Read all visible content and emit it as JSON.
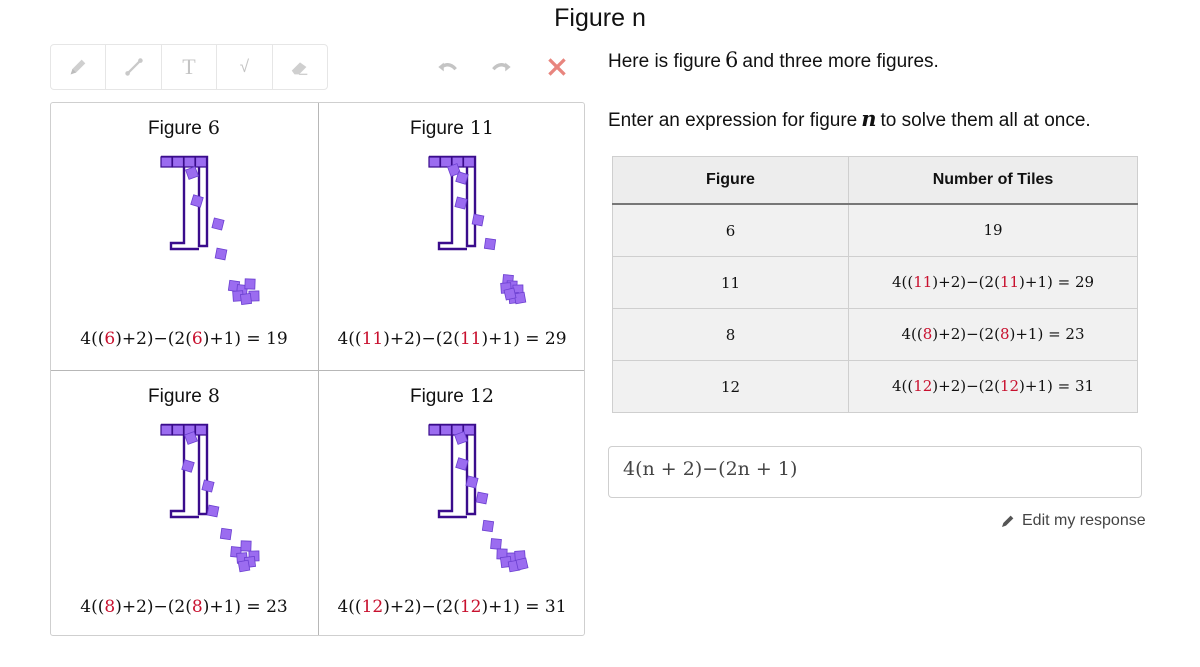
{
  "page": {
    "title": "Figure n"
  },
  "toolbar": {
    "tools": [
      {
        "icon": "pencil-icon"
      },
      {
        "icon": "line-icon"
      },
      {
        "icon": "text-icon",
        "glyph": "T"
      },
      {
        "icon": "square-root-icon",
        "glyph": "√"
      },
      {
        "icon": "eraser-icon"
      }
    ],
    "undo_icon": "undo-icon",
    "redo_icon": "redo-icon",
    "close_icon": "close-icon",
    "close_color": "#e8857e",
    "inactive_color": "#c4c4c4"
  },
  "figures": [
    {
      "label": "Figure",
      "number": "6",
      "n": "6",
      "result": "19"
    },
    {
      "label": "Figure",
      "number": "11",
      "n": "11",
      "result": "29"
    },
    {
      "label": "Figure",
      "number": "8",
      "n": "8",
      "result": "23"
    },
    {
      "label": "Figure",
      "number": "12",
      "n": "12",
      "result": "31"
    }
  ],
  "expression_parts": {
    "p1": "4(",
    "p2": "(",
    "p3": ")+2)−(2(",
    "p4": ")+1)",
    "eq": " = "
  },
  "prompt": {
    "line1_prefix": "Here is figure",
    "line1_number": "6",
    "line1_suffix": "and three more figures.",
    "line2_prefix": "Enter an expression for figure",
    "line2_var": "n",
    "line2_suffix": "to solve them all at once."
  },
  "table": {
    "headers": [
      "Figure",
      "Number of Tiles"
    ],
    "rows": [
      {
        "figure": "6",
        "tiles": "19",
        "is_expression": false
      },
      {
        "figure": "11",
        "n": "11",
        "result": "29",
        "is_expression": true
      },
      {
        "figure": "8",
        "n": "8",
        "result": "23",
        "is_expression": true
      },
      {
        "figure": "12",
        "n": "12",
        "result": "31",
        "is_expression": true
      }
    ]
  },
  "answer": {
    "value": "4(n + 2)−(2n + 1)"
  },
  "edit_link": {
    "label": "Edit my response",
    "icon": "pencil-icon"
  },
  "colors": {
    "accent_purple": "#9b6cf0",
    "outline_purple": "#3a0c8c",
    "red": "#c8102e"
  }
}
